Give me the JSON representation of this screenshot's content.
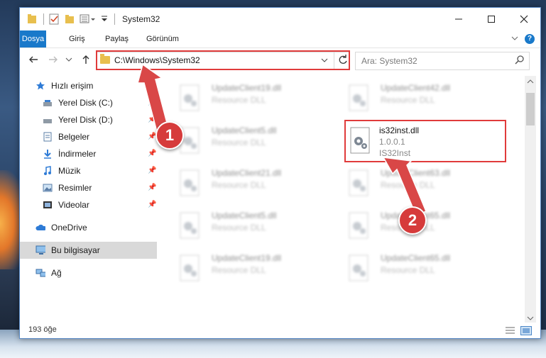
{
  "window": {
    "title": "System32"
  },
  "ribbon": {
    "tabs": [
      "Dosya",
      "Giriş",
      "Paylaş",
      "Görünüm"
    ],
    "help": "?"
  },
  "address": {
    "path": "C:\\Windows\\System32"
  },
  "search": {
    "placeholder": "Ara: System32"
  },
  "sidebar": {
    "quick_access": "Hızlı erişim",
    "items": [
      {
        "label": "Yerel Disk (C:)",
        "icon": "drive-icon",
        "pinned": true
      },
      {
        "label": "Yerel Disk (D:)",
        "icon": "drive-icon",
        "pinned": true
      },
      {
        "label": "Belgeler",
        "icon": "documents-icon",
        "pinned": true
      },
      {
        "label": "İndirmeler",
        "icon": "download-icon",
        "pinned": true
      },
      {
        "label": "Müzik",
        "icon": "music-icon",
        "pinned": true
      },
      {
        "label": "Resimler",
        "icon": "pictures-icon",
        "pinned": true
      },
      {
        "label": "Videolar",
        "icon": "video-icon",
        "pinned": true
      }
    ],
    "onedrive": "OneDrive",
    "this_pc": "Bu bilgisayar",
    "network": "Ağ"
  },
  "files": {
    "left": [
      {
        "name": "UpdateClient19.dll",
        "desc": "Resource DLL"
      },
      {
        "name": "UpdateClient5.dll",
        "desc": "Resource DLL"
      },
      {
        "name": "UpdateClient21.dll",
        "desc": "Resource DLL"
      },
      {
        "name": "UpdateClient5.dll",
        "desc": "Resource DLL"
      },
      {
        "name": "UpdateClient19.dll",
        "desc": "Resource DLL"
      }
    ],
    "right": [
      {
        "name": "UpdateClient42.dll",
        "desc": "Resource DLL"
      },
      {
        "name": "UpdateClient63.dll",
        "desc": "Resource DLL"
      },
      {
        "name": "UpdateClient65.dll",
        "desc": "Resource DLL"
      },
      {
        "name": "UpdateClient65.dll",
        "desc": "Resource DLL"
      }
    ],
    "highlighted": {
      "name": "is32inst.dll",
      "version": "1.0.0.1",
      "desc": "IS32Inst"
    }
  },
  "status": {
    "count": "193 öğe"
  },
  "annotations": {
    "step1": "1",
    "step2": "2"
  },
  "colors": {
    "accent": "#1979ca",
    "highlight": "#e03b3b"
  }
}
